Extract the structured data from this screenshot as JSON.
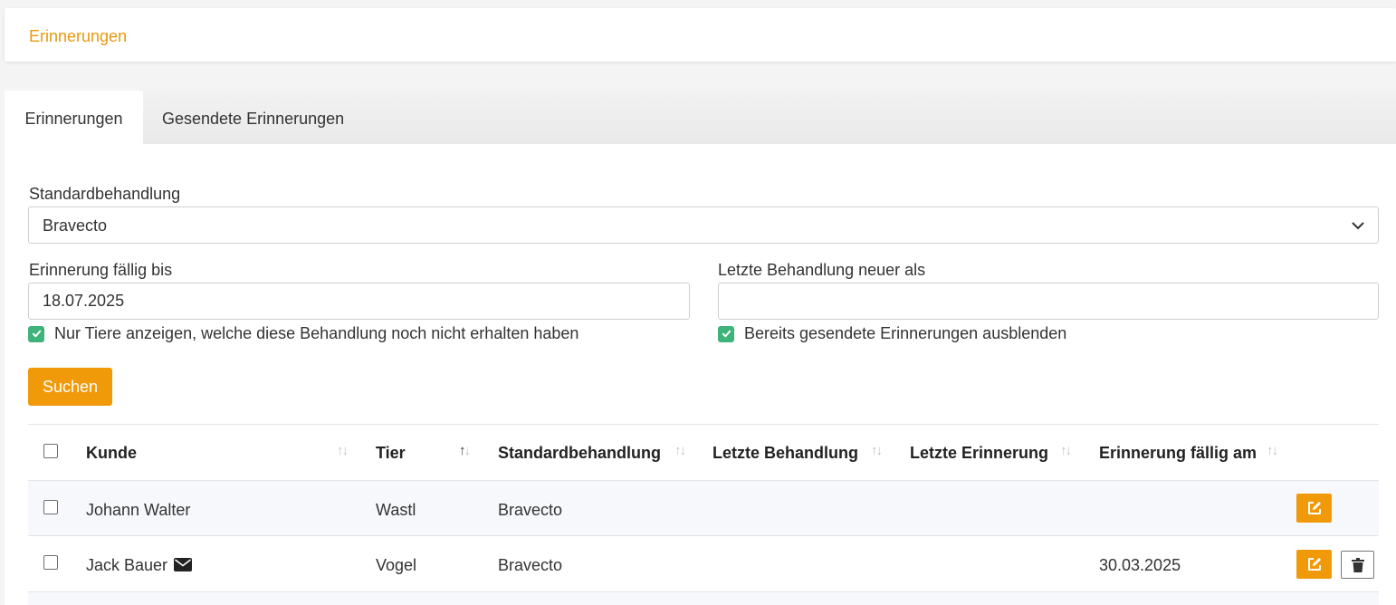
{
  "header": {
    "title": "Erinnerungen"
  },
  "tabs": [
    {
      "label": "Erinnerungen",
      "active": true
    },
    {
      "label": "Gesendete Erinnerungen",
      "active": false
    }
  ],
  "filters": {
    "treatment_label": "Standardbehandlung",
    "treatment_value": "Bravecto",
    "due_label": "Erinnerung fällig bis",
    "due_value": "18.07.2025",
    "last_treatment_label": "Letzte Behandlung neuer als",
    "last_treatment_value": "",
    "only_untreated_label": "Nur Tiere anzeigen, welche diese Behandlung noch nicht erhalten haben",
    "hide_sent_label": "Bereits gesendete Erinnerungen ausblenden",
    "search_label": "Suchen"
  },
  "table": {
    "columns": [
      "Kunde",
      "Tier",
      "Standardbehandlung",
      "Letzte Behandlung",
      "Letzte Erinnerung",
      "Erinnerung fällig am"
    ],
    "rows": [
      {
        "kunde": "Johann Walter",
        "tier": "Wastl",
        "behandlung": "Bravecto",
        "letzte_behandlung": "",
        "letzte_erinnerung": "",
        "faellig": "",
        "has_email": false
      },
      {
        "kunde": "Jack Bauer",
        "tier": "Vogel",
        "behandlung": "Bravecto",
        "letzte_behandlung": "",
        "letzte_erinnerung": "",
        "faellig": "30.03.2025",
        "has_email": true
      }
    ]
  },
  "colors": {
    "accent": "#f09a0a",
    "title": "#e8990f",
    "check": "#3eb37a"
  },
  "icons": [
    "chevron-down-icon",
    "check-icon",
    "sort-icon",
    "envelope-icon",
    "edit-icon",
    "trash-icon"
  ]
}
